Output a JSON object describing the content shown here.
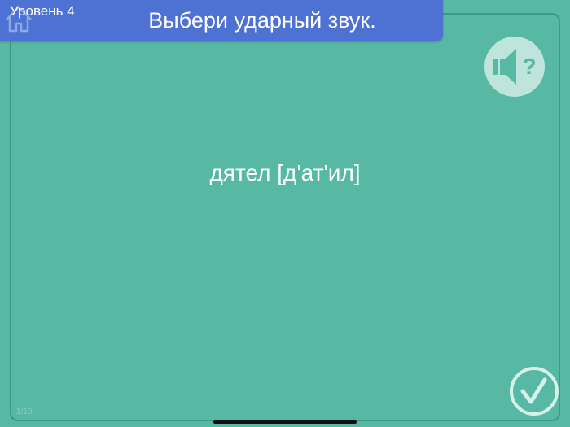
{
  "header": {
    "level_label": "Уровень 4",
    "instruction": "Выбери ударный звук."
  },
  "task": {
    "word": "дятел [д'ат'ил]"
  },
  "progress": {
    "text": "1/10"
  },
  "icons": {
    "home": "home-icon",
    "sound": "sound-help-icon",
    "check": "check-icon"
  },
  "colors": {
    "background": "#57b8a4",
    "header": "#4d72d3",
    "icon_light": "#bfe4db"
  }
}
